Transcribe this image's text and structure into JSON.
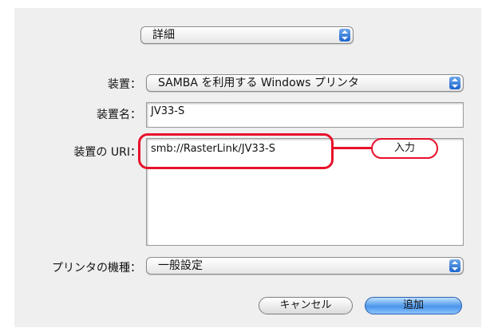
{
  "top_popup": {
    "value": "詳細"
  },
  "device": {
    "label": "装置：",
    "value": "SAMBA を利用する Windows プリンタ"
  },
  "device_name": {
    "label": "装置名：",
    "value": "JV33-S"
  },
  "device_uri": {
    "label": "装置の URI：",
    "value": "smb://RasterLink/JV33-S"
  },
  "printer_model": {
    "label": "プリンタの機種：",
    "value": "一般設定"
  },
  "buttons": {
    "cancel": "キャンセル",
    "add": "追加"
  },
  "annotation": {
    "text": "入力",
    "color": "#e8102a"
  }
}
